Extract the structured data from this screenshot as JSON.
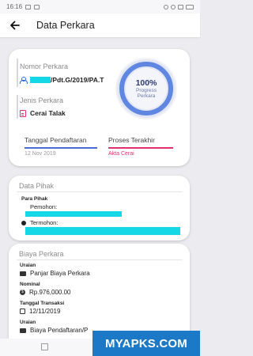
{
  "status_bar": {
    "time": "16:16"
  },
  "appbar": {
    "title": "Data Perkara"
  },
  "summary": {
    "nomor_label": "Nomor Perkara",
    "nomor_value": "/Pdt.G/2019/PA.T",
    "jenis_label": "Jenis Perkara",
    "jenis_value": "Cerai Talak",
    "progress_pct": "100%",
    "progress_line1": "Progress",
    "progress_line2": "Perkara",
    "progress_fraction": 1.0,
    "tanggal_label": "Tanggal Pendaftaran",
    "tanggal_value": "12 Nov 2019",
    "proses_label": "Proses Terakhir",
    "proses_value": "Akta Cerai"
  },
  "pihak": {
    "section_title": "Data Pihak",
    "para_pihak_label": "Para Pihak",
    "pemohon_label": "Pemohon:",
    "termohon_label": "Termohon:"
  },
  "biaya": {
    "section_title": "Biaya Perkara",
    "uraian_label": "Uraian",
    "uraian_value": "Panjar Biaya Perkara",
    "nominal_label": "Nominal",
    "nominal_value": "Rp.976,000.00",
    "tanggal_label": "Tanggal Transaksi",
    "tanggal_value": "12/11/2019",
    "uraian2_label": "Uraian",
    "uraian2_value": "Biaya Pendaftaran/P"
  },
  "watermark": {
    "text": "MYAPKS.COM"
  },
  "colors": {
    "accent_blue": "#4b6bd8",
    "accent_pink": "#e0306e",
    "redaction": "#14d8e6",
    "watermark_bg": "#1c79c8"
  }
}
